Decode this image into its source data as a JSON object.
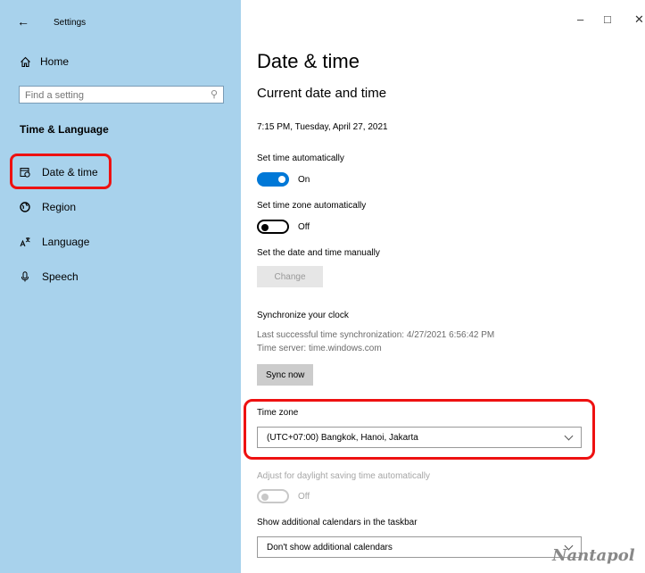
{
  "window": {
    "title": "Settings",
    "back_icon": "←",
    "minimize_icon": "–",
    "maximize_icon": "□",
    "close_icon": "✕"
  },
  "sidebar": {
    "home_label": "Home",
    "search_placeholder": "Find a setting",
    "section_title": "Time & Language",
    "items": [
      {
        "label": "Date & time",
        "icon": "calendar-clock-icon"
      },
      {
        "label": "Region",
        "icon": "globe-icon"
      },
      {
        "label": "Language",
        "icon": "language-icon"
      },
      {
        "label": "Speech",
        "icon": "microphone-icon"
      }
    ]
  },
  "main": {
    "page_title": "Date & time",
    "section_title": "Current date and time",
    "current_datetime": "7:15 PM, Tuesday, April 27, 2021",
    "set_time_auto": {
      "label": "Set time automatically",
      "state": "On"
    },
    "set_tz_auto": {
      "label": "Set time zone automatically",
      "state": "Off"
    },
    "manual": {
      "label": "Set the date and time manually",
      "button": "Change"
    },
    "sync": {
      "title": "Synchronize your clock",
      "last_sync": "Last successful time synchronization: 4/27/2021 6:56:42 PM",
      "server": "Time server: time.windows.com",
      "button": "Sync now"
    },
    "time_zone": {
      "label": "Time zone",
      "value": "(UTC+07:00) Bangkok, Hanoi, Jakarta"
    },
    "dst": {
      "label": "Adjust for daylight saving time automatically",
      "state": "Off"
    },
    "calendars": {
      "label": "Show additional calendars in the taskbar",
      "value": "Don't show additional calendars"
    }
  },
  "watermark": "Nantapol",
  "colors": {
    "sidebar_bg": "#a8d2ec",
    "accent": "#0078d7",
    "highlight": "#ee1111"
  }
}
